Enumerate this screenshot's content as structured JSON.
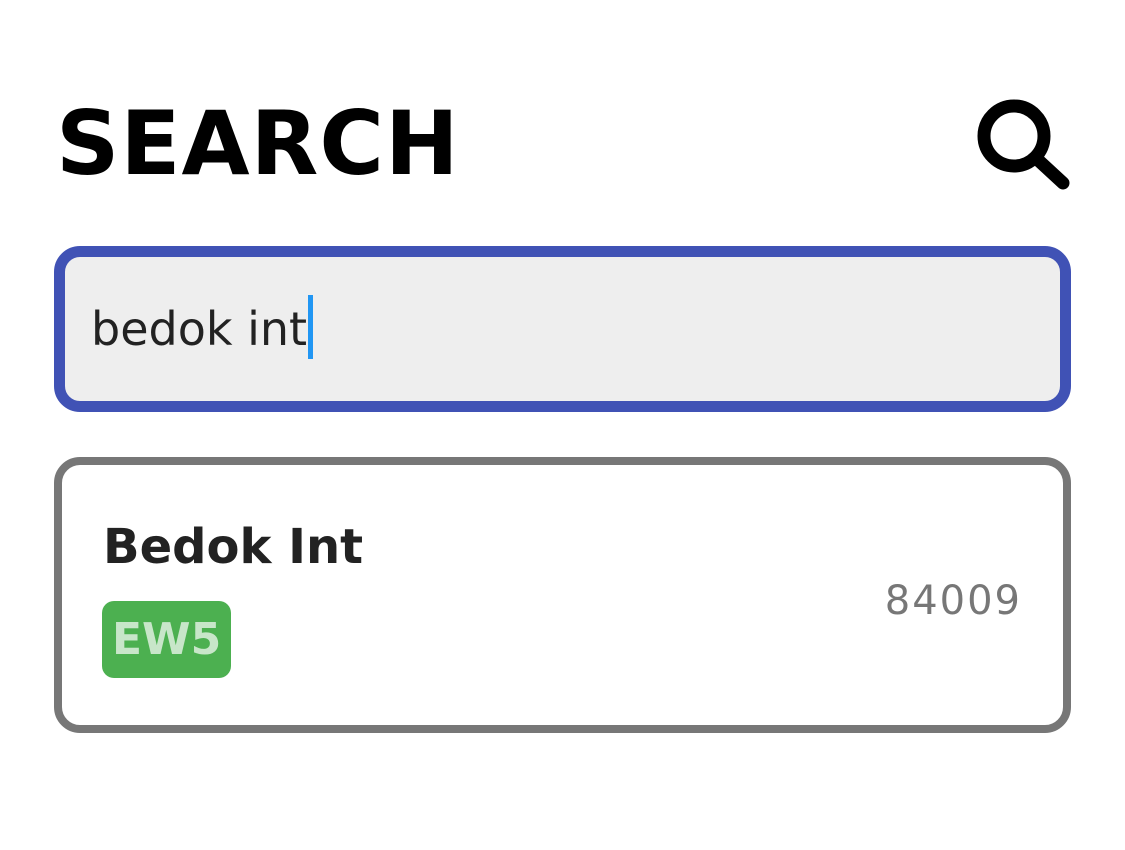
{
  "header": {
    "title": "SEARCH",
    "search_icon": "search-icon"
  },
  "search": {
    "value": "bedok int",
    "focused": true,
    "border_color": "#4052b5",
    "caret_color": "#2196f3"
  },
  "results": [
    {
      "name": "Bedok Int",
      "code": "84009",
      "lines": [
        {
          "label": "EW5",
          "color": "#4cb050",
          "text_color": "#c8e6c9"
        }
      ]
    }
  ]
}
